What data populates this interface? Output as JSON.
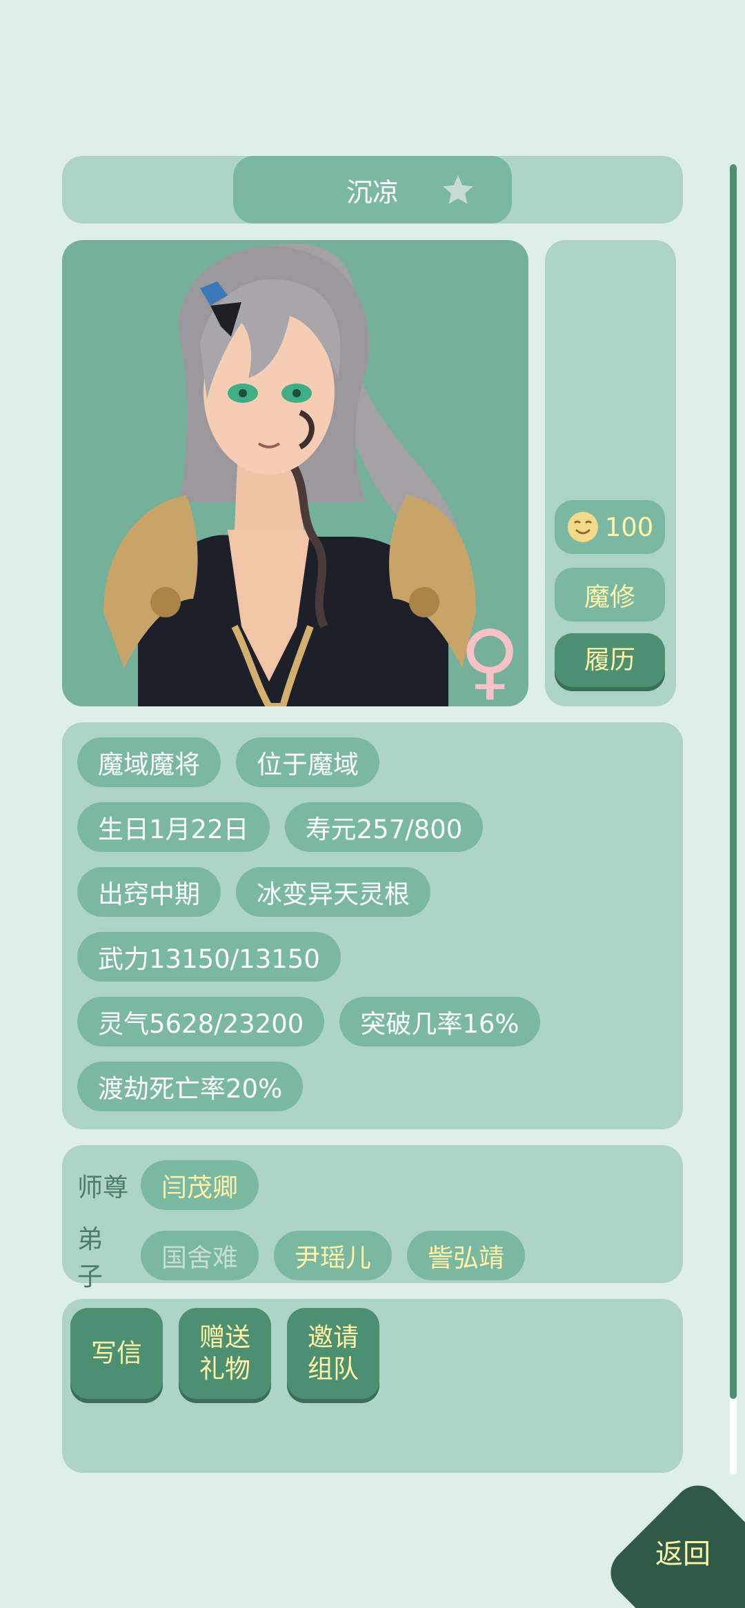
{
  "header": {
    "name": "沉凉",
    "favorite_icon": "star-icon"
  },
  "side": {
    "mood_value": "100",
    "mood_icon": "smile-face-icon",
    "sect_type": "魔修",
    "resume_label": "履历",
    "gender_symbol": "♀"
  },
  "info_tags": [
    [
      "魔域魔将",
      "位于魔域"
    ],
    [
      "生日1月22日",
      "寿元257/800"
    ],
    [
      "出窍中期",
      "冰变异天灵根"
    ],
    [
      "武力13150/13150"
    ],
    [
      "灵气5628/23200",
      "突破几率16%"
    ],
    [
      "渡劫死亡率20%"
    ]
  ],
  "relations": {
    "master_label": "师尊",
    "master_name": "闫茂卿",
    "disciple_label": "弟子",
    "disciples": [
      "国舍难",
      "尹瑶儿",
      "訾弘靖"
    ]
  },
  "actions": {
    "write_letter": "写信",
    "gift": "赠送\n礼物",
    "invite_team": "邀请\n组队"
  },
  "back_label": "返回",
  "colors": {
    "background": "#deefea",
    "panel": "#aed4c7",
    "pill": "#7ab8a1",
    "button": "#4c8f71",
    "gold_text": "#fff3a8",
    "back_button": "#2f5a47",
    "gender_pink": "#f6c2c6"
  }
}
